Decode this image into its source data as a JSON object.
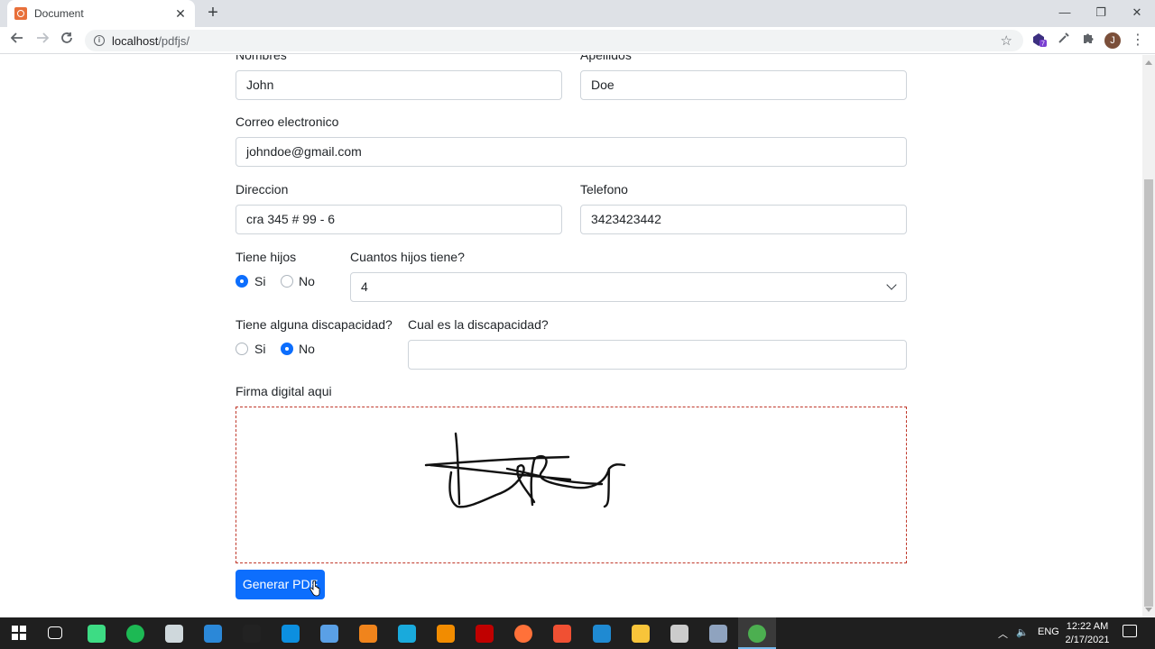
{
  "browser": {
    "tab_title": "Document",
    "tab_close": "✕",
    "new_tab": "+",
    "url_host": "localhost",
    "url_path": "/pdfjs/",
    "window_controls": [
      "—",
      "❐",
      "✕"
    ],
    "avatar_initial": "J",
    "extension_badge": "7"
  },
  "form": {
    "nombres_label": "Nombres",
    "nombres_value": "John",
    "apellidos_label": "Apellidos",
    "apellidos_value": "Doe",
    "correo_label": "Correo electronico",
    "correo_value": "johndoe@gmail.com",
    "direccion_label": "Direccion",
    "direccion_value": "cra 345 # 99 - 6",
    "telefono_label": "Telefono",
    "telefono_value": "3423423442",
    "hijos_label": "Tiene hijos",
    "hijos_si": "Si",
    "hijos_no": "No",
    "hijos_selected": "Si",
    "cuantos_label": "Cuantos hijos tiene?",
    "cuantos_value": "4",
    "discapacidad_label": "Tiene alguna discapacidad?",
    "discapacidad_si": "Si",
    "discapacidad_no": "No",
    "discapacidad_selected": "No",
    "cual_label": "Cual es la discapacidad?",
    "cual_value": "",
    "firma_label": "Firma digital aqui",
    "submit_label": "Generar PDF"
  },
  "taskbar": {
    "language": "ENG",
    "time": "12:22 AM",
    "date": "2/17/2021",
    "apps": [
      "windows-start",
      "task-view",
      "android-studio",
      "spotify",
      "files-app",
      "mail",
      "terminal",
      "edge",
      "virtualbox",
      "sublime-text",
      "cisco-app",
      "vlc",
      "filezilla",
      "firefox",
      "git-gui",
      "vscode",
      "file-explorer",
      "obs",
      "remote-app",
      "chrome"
    ]
  },
  "colors": {
    "primary": "#0d6efd",
    "signature_border": "#c0392b"
  }
}
